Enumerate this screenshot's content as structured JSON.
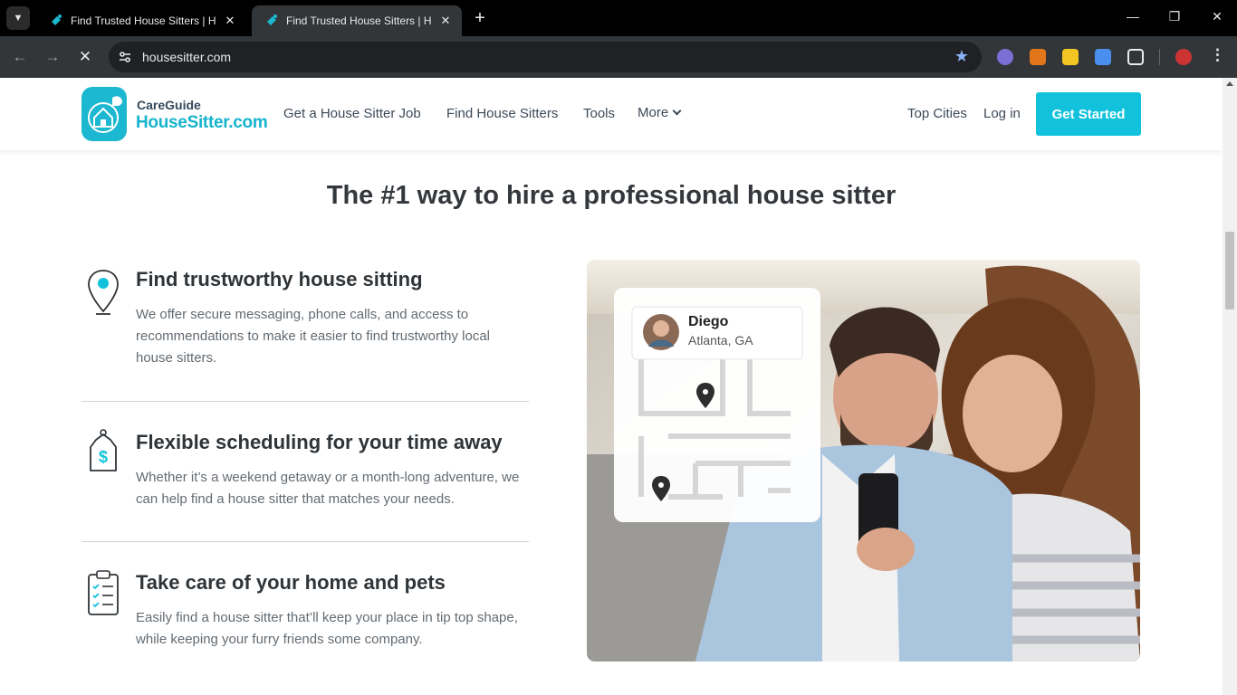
{
  "browser": {
    "tabs": [
      {
        "title": "Find Trusted House Sitters | House",
        "active": false
      },
      {
        "title": "Find Trusted House Sitters | House",
        "active": true
      }
    ],
    "url": "housesitter.com",
    "accent": "#8ab4f8"
  },
  "site": {
    "logo_top": "CareGuide",
    "logo_main": "HouseSitter.com",
    "nav": [
      "Get a House Sitter Job",
      "Find House Sitters",
      "Tools",
      "More"
    ],
    "top_cities": "Top Cities",
    "login": "Log in",
    "cta": "Get Started",
    "brand_color": "#12c2dc"
  },
  "main": {
    "headline": "The #1 way to hire a professional house sitter",
    "features": [
      {
        "icon": "map-pin-icon",
        "title": "Find trustworthy house sitting",
        "text": "We offer secure messaging, phone calls, and access to recommendations to make it easier to find trustworthy local house sitters."
      },
      {
        "icon": "price-tag-icon",
        "title": "Flexible scheduling for your time away",
        "text": "Whether it’s a weekend getaway or a month-long adventure, we can help find a house sitter that matches your needs."
      },
      {
        "icon": "checklist-clipboard-icon",
        "title": "Take care of your home and pets",
        "text": "Easily find a house sitter that’ll keep your place in tip top shape, while keeping your furry friends some company."
      }
    ],
    "profile_card": {
      "name": "Diego",
      "location": "Atlanta, GA"
    }
  }
}
